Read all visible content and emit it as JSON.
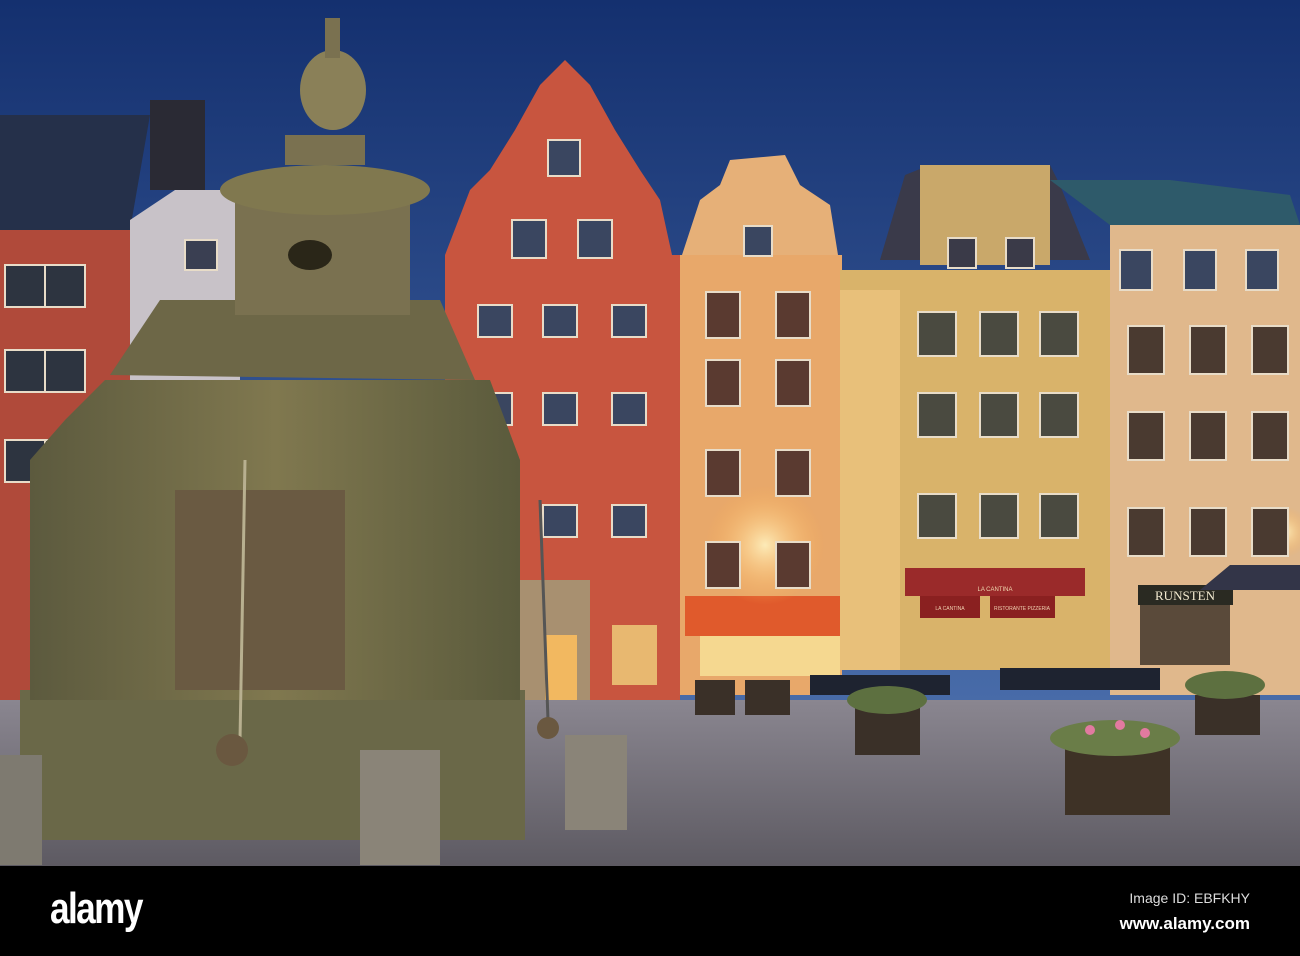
{
  "watermark": {
    "logo": "alamy",
    "image_id": "Image ID: EBFKHY",
    "url": "www.alamy.com"
  },
  "scene": {
    "signs": {
      "shop": "RUNSTEN",
      "restaurant_awning": "LA CANTINA",
      "restaurant_banner_left": "LA CANTINA",
      "restaurant_banner_right": "RISTORANTE PIZZERIA"
    }
  },
  "colors": {
    "sky_top": "#14306f",
    "sky_bottom": "#4f74b4",
    "red_building": "#c8553f",
    "orange_building": "#e8a86a",
    "yellow_building": "#d9b36a",
    "peach_building": "#e0b88c",
    "fountain": "#6f6a4a",
    "cobblestone": "#77737c"
  }
}
